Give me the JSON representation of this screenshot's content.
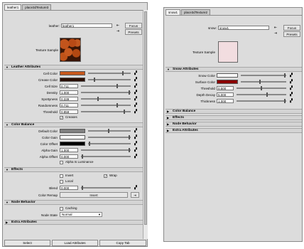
{
  "left": {
    "tabs": [
      "leather1",
      "place3dTexture3"
    ],
    "node_label": "leather:",
    "node_value": "leather1",
    "focus_label": "Focus",
    "presets_label": "Presets",
    "texture_sample_label": "Texture Sample",
    "leather_section": "Leather Attributes",
    "cell_color_label": "Cell Color",
    "crease_color_label": "Crease Color",
    "cell_size_label": "Cell Size",
    "cell_size_value": "0.711",
    "density_label": "Density",
    "density_value": "1.000",
    "spottyness_label": "Spottyness",
    "spottyness_value": "0.339",
    "randomness_label": "Randomness",
    "randomness_value": "0.711",
    "threshold_label": "Threshold",
    "threshold_value": "0.859",
    "creases_label": "Creases",
    "color_balance_section": "Color Balance",
    "default_color_label": "Default Color",
    "color_gain_label": "Color Gain",
    "color_offset_label": "Color Offset",
    "alpha_gain_label": "Alpha Gain",
    "alpha_gain_value": "1.000",
    "alpha_offset_label": "Alpha Offset",
    "alpha_offset_value": "0.000",
    "alpha_is_luminance_label": "Alpha Is Luminance",
    "effects_section": "Effects",
    "invert_label": "Invert",
    "wrap_label": "Wrap",
    "local_label": "Local",
    "blend_label": "Blend",
    "blend_value": "0.000",
    "color_remap_label": "Color Remap",
    "insert_label": "Insert",
    "node_behavior_section": "Node Behavior",
    "caching_label": "Caching",
    "node_state_label": "Node State",
    "node_state_value": "Normal",
    "extra_section": "Extra Attributes",
    "select_button": "Select",
    "load_attributes_button": "Load Attributes",
    "copy_tab_button": "Copy Tab"
  },
  "right": {
    "tabs": [
      "snow1",
      "place3dTexture2"
    ],
    "node_label": "snow:",
    "node_value": "snow1",
    "focus_label": "Focus",
    "presets_label": "Presets",
    "texture_sample_label": "Texture Sample",
    "snow_section": "Snow Attributes",
    "snow_color_label": "Snow Color",
    "surface_color_label": "Surface Color",
    "threshold_label": "Threshold",
    "threshold_value": "0.500",
    "depth_decay_label": "Depth Decay",
    "depth_decay_value": "5.000",
    "thickness_label": "Thickness",
    "thickness_value": "1.000",
    "color_balance_section": "Color Balance",
    "effects_section": "Effects",
    "node_behavior_section": "Node Behavior",
    "extra_section": "Extra Attributes"
  },
  "colors": {
    "cell_color": "#c8581c",
    "crease_color": "#2a0e03",
    "default_color": "#808080",
    "color_gain": "#ffffff",
    "color_offset": "#000000",
    "snow_color": "#ffffff",
    "surface_color": "#8b0000",
    "snow_texture": "#f2dde0"
  },
  "icons": {
    "map_button": "checker-map-icon",
    "expanded": "triangle-down-icon",
    "collapsed": "triangle-right-icon"
  }
}
